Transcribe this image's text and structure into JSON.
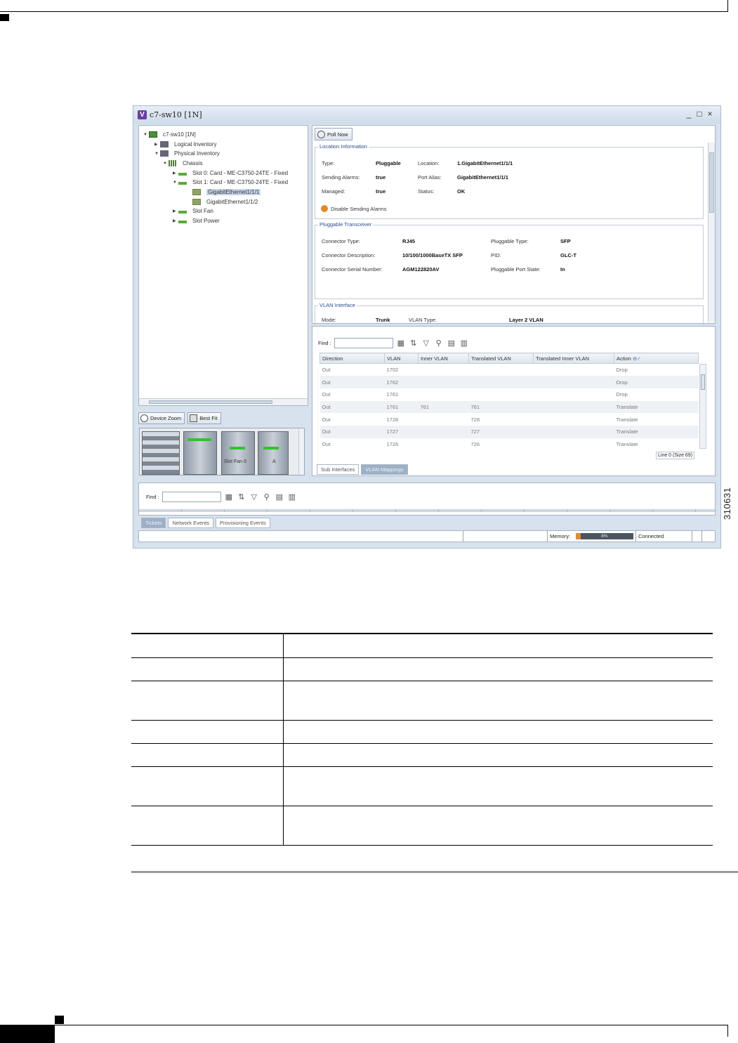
{
  "figure_id": "310631",
  "window": {
    "title": "c7-sw10 [1N]",
    "controls": [
      "_",
      "□",
      "×"
    ]
  },
  "tree": [
    {
      "label": "c7-sw10 [1N]",
      "icon": "device-icon",
      "level": 0
    },
    {
      "label": "Logical Inventory",
      "icon": "logical-inventory-icon",
      "level": 1
    },
    {
      "label": "Physical Inventory",
      "icon": "physical-inventory-icon",
      "level": 1
    },
    {
      "label": "Chassis",
      "icon": "chassis-icon",
      "level": 2
    },
    {
      "label": "Slot 0: Card - ME-C3750-24TE - Fixed",
      "icon": "card-icon",
      "level": 3
    },
    {
      "label": "Slot 1: Card - ME-C3750-24TE - Fixed",
      "icon": "card-icon",
      "level": 3
    },
    {
      "label": "GigabitEthernet1/1/1",
      "icon": "port-icon",
      "level": 4,
      "selected": true
    },
    {
      "label": "GigabitEthernet1/1/2",
      "icon": "port-icon",
      "level": 4
    },
    {
      "label": "Slot Fan",
      "icon": "card-icon",
      "level": 3
    },
    {
      "label": "Slot Power",
      "icon": "card-icon",
      "level": 3
    }
  ],
  "zoom_controls": {
    "device_zoom": "Device Zoom",
    "best_fit": "Best Fit"
  },
  "chassis_view": {
    "slot_fan_label": "Slot Fan 0",
    "slot_a_label": "A"
  },
  "details": {
    "poll_now": "Poll Now",
    "location": {
      "title": "Location Information",
      "type_label": "Type:",
      "type_value": "Pluggable",
      "location_label": "Location:",
      "location_value": "1.GigabitEthernet1/1/1",
      "sending_alarms_label": "Sending Alarms:",
      "sending_alarms_value": "true",
      "port_alias_label": "Port Alias:",
      "port_alias_value": "GigabitEthernet1/1/1",
      "managed_label": "Managed:",
      "managed_value": "true",
      "status_label": "Status:",
      "status_value": "OK",
      "disable_alarms": "Disable Sending Alarms"
    },
    "transceiver": {
      "title": "Pluggable Transceiver",
      "connector_type_label": "Connector Type:",
      "connector_type_value": "RJ45",
      "pluggable_type_label": "Pluggable Type:",
      "pluggable_type_value": "SFP",
      "connector_desc_label": "Connector Description:",
      "connector_desc_value": "10/100/1000BaseTX SFP",
      "pid_label": "PID:",
      "pid_value": "GLC-T",
      "serial_label": "Connector Serial Number:",
      "serial_value": "AGM122820AV",
      "port_state_label": "Pluggable Port State:",
      "port_state_value": "In"
    },
    "vlan_interface": {
      "title": "VLAN Interface",
      "mode_label": "Mode:",
      "mode_value": "Trunk",
      "vlan_type_label": "VLAN Type:",
      "vlan_type_value": "Layer 2 VLAN"
    }
  },
  "vlan_table": {
    "find_label": "Find :",
    "columns": [
      "Direction",
      "VLAN",
      "Inner VLAN",
      "Translated VLAN",
      "Translated Inner VLAN",
      "Action"
    ],
    "rows": [
      [
        "Out",
        "1702",
        "",
        "",
        "",
        "Drop"
      ],
      [
        "Out",
        "1762",
        "",
        "",
        "",
        "Drop"
      ],
      [
        "Out",
        "1761",
        "",
        "",
        "",
        "Drop"
      ],
      [
        "Out",
        "1761",
        "761",
        "761",
        "",
        "Translate"
      ],
      [
        "Out",
        "1728",
        "",
        "728",
        "",
        "Translate"
      ],
      [
        "Out",
        "1727",
        "",
        "727",
        "",
        "Translate"
      ],
      [
        "Out",
        "1726",
        "",
        "726",
        "",
        "Translate"
      ]
    ],
    "line_info": "Line 0 (Size 69)",
    "tabs": [
      {
        "label": "Sub Interfaces",
        "active": false
      },
      {
        "label": "VLAN Mappings",
        "active": true
      }
    ]
  },
  "events": {
    "find_label": "Find :",
    "tabs": [
      {
        "label": "Tickets",
        "active": true
      },
      {
        "label": "Network Events",
        "active": false
      },
      {
        "label": "Provisioning Events",
        "active": false
      }
    ]
  },
  "status_bar": {
    "memory_label": "Memory:",
    "memory_value": "8%",
    "memory_fraction": 0.08,
    "connection": "Connected"
  },
  "ref_table": {
    "row_count": 7
  }
}
